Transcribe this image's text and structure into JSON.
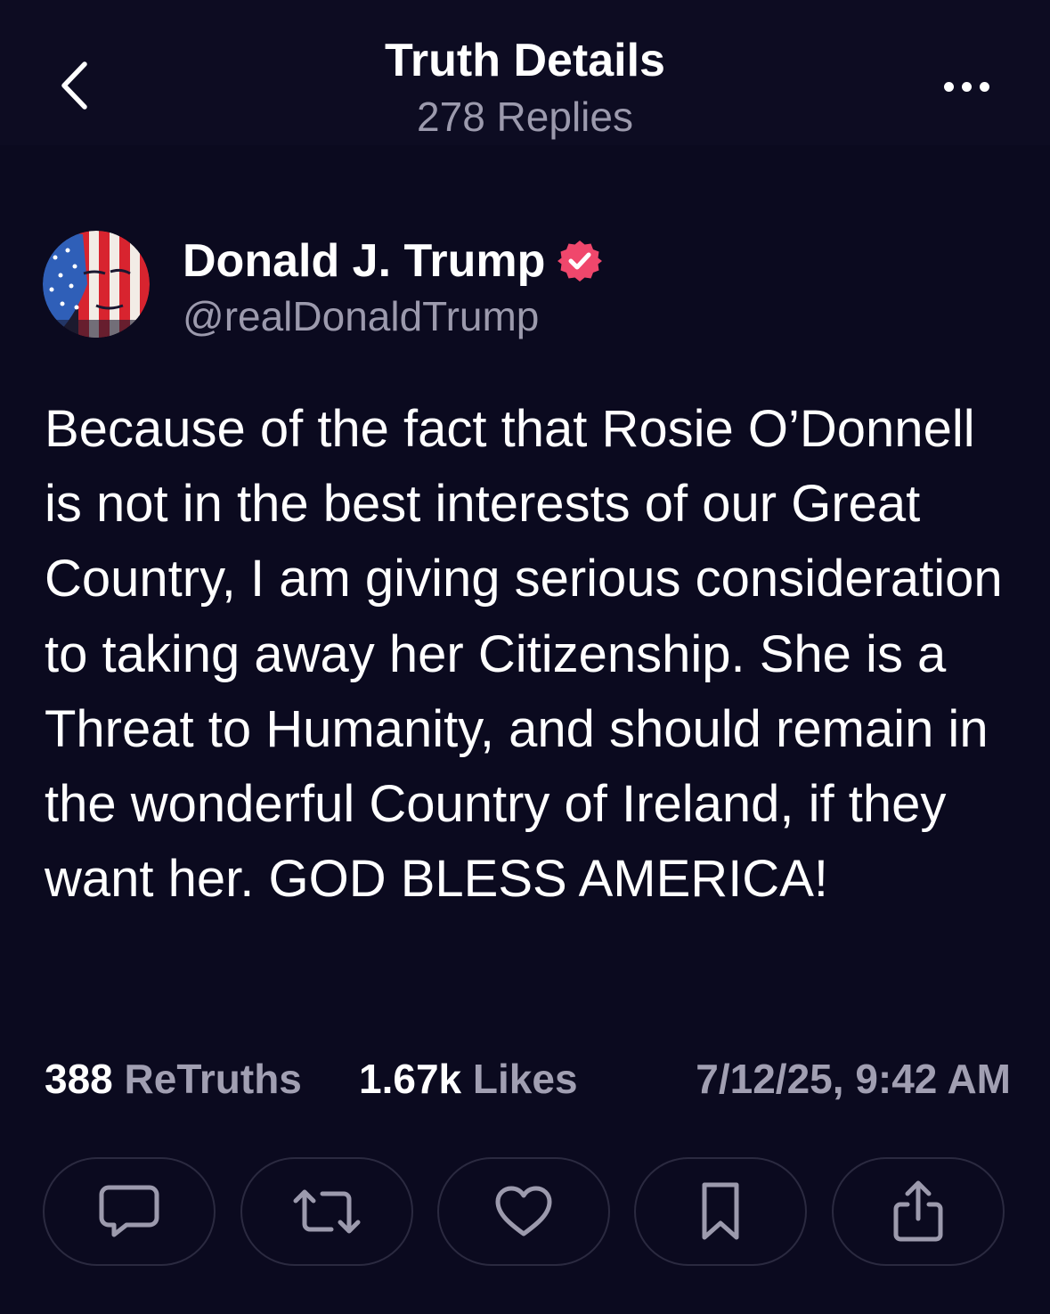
{
  "header": {
    "title": "Truth Details",
    "subtitle": "278 Replies",
    "back_icon": "chevron-left-icon",
    "more_icon": "ellipsis-icon"
  },
  "author": {
    "display_name": "Donald J. Trump",
    "handle": "@realDonaldTrump",
    "verified": true,
    "verified_color": "#f0476c"
  },
  "post": {
    "text": "Because of the fact that Rosie O’Donnell is not in the best interests of our Great Country, I am giving serious consideration to taking away her Citizenship. She is a Threat to Humanity, and should remain in the wonderful Country of Ireland, if they want her. GOD BLESS AMERICA!"
  },
  "stats": {
    "retruths_count": "388",
    "retruths_label": "ReTruths",
    "likes_count": "1.67k",
    "likes_label": "Likes",
    "timestamp": "7/12/25, 9:42 AM"
  },
  "actions": [
    {
      "name": "reply",
      "icon": "comment-icon"
    },
    {
      "name": "retruth",
      "icon": "repost-icon"
    },
    {
      "name": "like",
      "icon": "heart-icon"
    },
    {
      "name": "bookmark",
      "icon": "bookmark-icon"
    },
    {
      "name": "share",
      "icon": "share-icon"
    }
  ],
  "colors": {
    "background": "#0b0a1f",
    "muted_text": "#9c9aad",
    "button_border": "#2b2a40"
  }
}
